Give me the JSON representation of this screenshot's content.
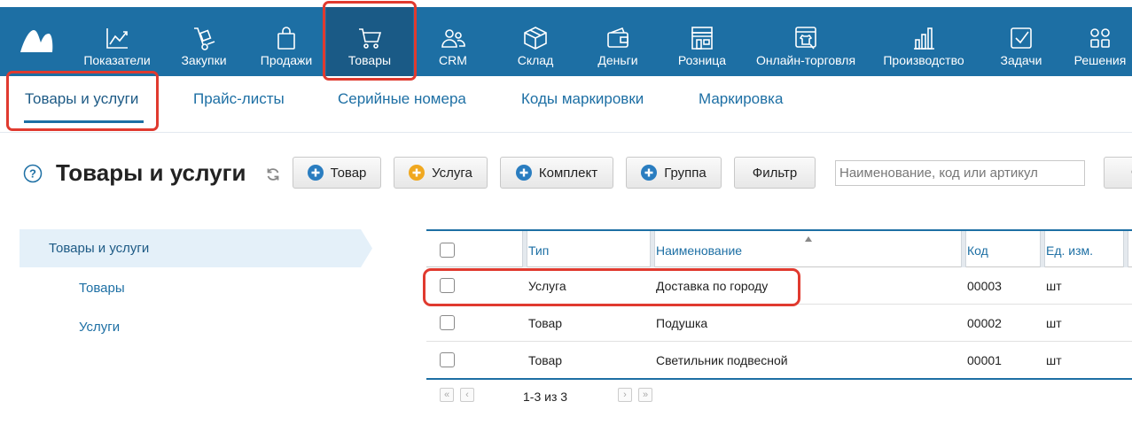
{
  "colors": {
    "nav_bg": "#1d6fa4",
    "nav_active": "#1a5a86",
    "link": "#1d6fa4",
    "highlight": "#e03a2f",
    "plus_blue": "#2a7dc0",
    "plus_orange": "#f0a820"
  },
  "nav": [
    {
      "label": "Показатели",
      "icon": "chart-line-icon"
    },
    {
      "label": "Закупки",
      "icon": "hand-truck-icon"
    },
    {
      "label": "Продажи",
      "icon": "shopping-bag-icon"
    },
    {
      "label": "Товары",
      "icon": "cart-icon",
      "active": true
    },
    {
      "label": "CRM",
      "icon": "people-icon"
    },
    {
      "label": "Склад",
      "icon": "box-icon"
    },
    {
      "label": "Деньги",
      "icon": "wallet-icon"
    },
    {
      "label": "Розница",
      "icon": "store-icon"
    },
    {
      "label": "Онлайн-торговля",
      "icon": "online-shop-icon"
    },
    {
      "label": "Производство",
      "icon": "factory-icon"
    },
    {
      "label": "Задачи",
      "icon": "checkbox-icon"
    },
    {
      "label": "Решения",
      "icon": "apps-grid-icon"
    }
  ],
  "subtabs": [
    {
      "label": "Товары и услуги",
      "active": true
    },
    {
      "label": "Прайс-листы"
    },
    {
      "label": "Серийные номера"
    },
    {
      "label": "Коды маркировки"
    },
    {
      "label": "Маркировка"
    }
  ],
  "page": {
    "title": "Товары и услуги"
  },
  "toolbar": {
    "buttons": [
      {
        "label": "Товар",
        "icon": "plus-circle-blue-icon"
      },
      {
        "label": "Услуга",
        "icon": "plus-circle-orange-icon"
      },
      {
        "label": "Комплект",
        "icon": "plus-circle-blue-icon"
      },
      {
        "label": "Группа",
        "icon": "plus-circle-blue-icon"
      },
      {
        "label": "Фильтр"
      }
    ],
    "search_placeholder": "Наименование, код или артикул",
    "cut_button_label": "О"
  },
  "tree": {
    "root": "Товары и услуги",
    "children": [
      "Товары",
      "Услуги"
    ]
  },
  "table": {
    "columns": [
      "Тип",
      "Наименование",
      "Код",
      "Ед. изм."
    ],
    "sorted_column": "Наименование",
    "rows": [
      {
        "type": "Услуга",
        "name": "Доставка по городу",
        "code": "00003",
        "unit": "шт",
        "highlighted": true
      },
      {
        "type": "Товар",
        "name": "Подушка",
        "code": "00002",
        "unit": "шт"
      },
      {
        "type": "Товар",
        "name": "Светильник подвесной",
        "code": "00001",
        "unit": "шт"
      }
    ]
  },
  "pagination": {
    "text": "1-3 из 3",
    "first": "«",
    "prev": "‹",
    "next": "›",
    "last": "»"
  }
}
